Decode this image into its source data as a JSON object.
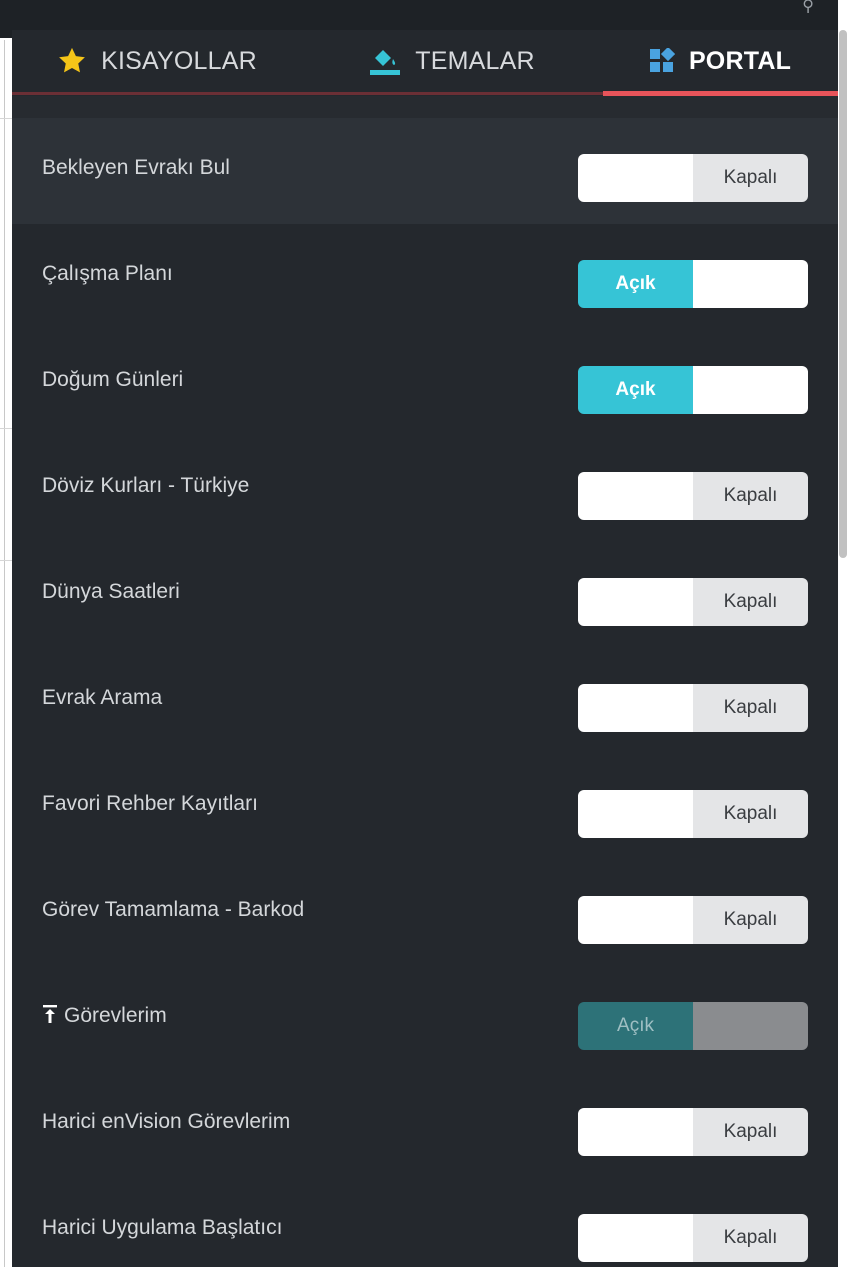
{
  "tabs": [
    {
      "label": "KISAYOLLAR",
      "icon": "star-icon",
      "icon_color": "#f5c518"
    },
    {
      "label": "TEMALAR",
      "icon": "paint-bucket-icon",
      "icon_color": "#36c4d6"
    },
    {
      "label": "PORTAL",
      "icon": "widgets-icon",
      "icon_color": "#4aa3e0",
      "active": true
    }
  ],
  "accent_color": "#e8545a",
  "toggle_on_color": "#36c4d6",
  "items": [
    {
      "label": "Bekleyen Evrakı Bul",
      "state": "Kapalı",
      "on": false
    },
    {
      "label": "Çalışma Planı",
      "state": "Açık",
      "on": true
    },
    {
      "label": "Doğum Günleri",
      "state": "Açık",
      "on": true
    },
    {
      "label": "Döviz Kurları - Türkiye",
      "state": "Kapalı",
      "on": false
    },
    {
      "label": "Dünya Saatleri",
      "state": "Kapalı",
      "on": false
    },
    {
      "label": "Evrak Arama",
      "state": "Kapalı",
      "on": false
    },
    {
      "label": "Favori Rehber Kayıtları",
      "state": "Kapalı",
      "on": false
    },
    {
      "label": "Görev Tamamlama - Barkod",
      "state": "Kapalı",
      "on": false
    },
    {
      "label": "Görevlerim",
      "state": "Açık",
      "on": true,
      "disabled": true,
      "pin_icon": "pin-top-icon"
    },
    {
      "label": "Harici enVision Görevlerim",
      "state": "Kapalı",
      "on": false
    },
    {
      "label": "Harici Uygulama Başlatıcı",
      "state": "Kapalı",
      "on": false
    }
  ]
}
